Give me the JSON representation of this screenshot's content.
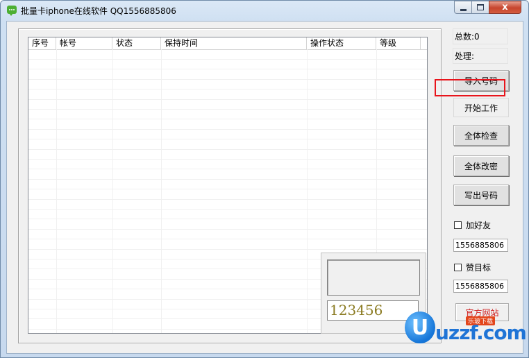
{
  "window": {
    "title": "批量卡iphone在线软件 QQ1556885806",
    "close_glyph": "x"
  },
  "table": {
    "columns": [
      "序号",
      "帐号",
      "状态",
      "保持时间",
      "操作状态",
      "等级"
    ],
    "rows": []
  },
  "side": {
    "total_label": "总数:0",
    "processing_label": "处理:",
    "buttons": {
      "import": "导入号码",
      "start": "开始工作",
      "check_all": "全体检查",
      "change_pw_all": "全体改密",
      "export": "写出号码"
    },
    "add_friend": {
      "label": "加好友",
      "checked": false,
      "value": "1556885806"
    },
    "like_target": {
      "label": "赞目标",
      "checked": false,
      "value": "1556885806"
    },
    "official_site": "官方网站"
  },
  "captcha": {
    "input_value": "123456"
  },
  "watermark": {
    "logo_letter": "U",
    "text": "uzzf.com",
    "tag": "乐玻下载"
  },
  "colors": {
    "highlight": "#e8141b",
    "official_text": "#d02020"
  }
}
